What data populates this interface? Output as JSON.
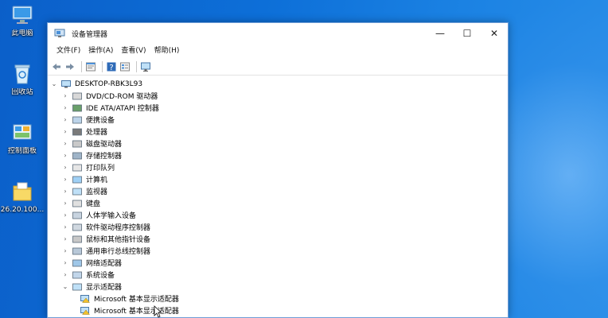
{
  "desktop": {
    "icons": [
      {
        "label": "此电脑",
        "icon": "computer-icon"
      },
      {
        "label": "回收站",
        "icon": "recycle-bin-icon"
      },
      {
        "label": "控制面板",
        "icon": "control-panel-icon"
      },
      {
        "label": "26.20.100...",
        "icon": "folder-icon"
      }
    ]
  },
  "window": {
    "title": "设备管理器",
    "controls": {
      "minimize": "—",
      "maximize": "☐",
      "close": "✕"
    },
    "menu": [
      "文件(F)",
      "操作(A)",
      "查看(V)",
      "帮助(H)"
    ],
    "toolbar": [
      "back-icon",
      "forward-icon",
      "properties-icon",
      "help-icon",
      "view-icon",
      "monitor-icon"
    ]
  },
  "tree": {
    "root": "DESKTOP-RBK3L93",
    "items": [
      {
        "label": "DVD/CD-ROM 驱动器",
        "icon": "dvd-drive-icon",
        "expanded": false
      },
      {
        "label": "IDE ATA/ATAPI 控制器",
        "icon": "ide-controller-icon",
        "expanded": false
      },
      {
        "label": "便携设备",
        "icon": "portable-device-icon",
        "expanded": false
      },
      {
        "label": "处理器",
        "icon": "processor-icon",
        "expanded": false
      },
      {
        "label": "磁盘驱动器",
        "icon": "disk-drive-icon",
        "expanded": false
      },
      {
        "label": "存储控制器",
        "icon": "storage-controller-icon",
        "expanded": false
      },
      {
        "label": "打印队列",
        "icon": "printer-icon",
        "expanded": false
      },
      {
        "label": "计算机",
        "icon": "computer-icon",
        "expanded": false
      },
      {
        "label": "监视器",
        "icon": "monitor-icon",
        "expanded": false
      },
      {
        "label": "键盘",
        "icon": "keyboard-icon",
        "expanded": false
      },
      {
        "label": "人体学输入设备",
        "icon": "hid-icon",
        "expanded": false
      },
      {
        "label": "软件驱动程序控制器",
        "icon": "software-device-icon",
        "expanded": false
      },
      {
        "label": "鼠标和其他指针设备",
        "icon": "mouse-icon",
        "expanded": false
      },
      {
        "label": "通用串行总线控制器",
        "icon": "usb-icon",
        "expanded": false
      },
      {
        "label": "网络适配器",
        "icon": "network-adapter-icon",
        "expanded": false
      },
      {
        "label": "系统设备",
        "icon": "system-device-icon",
        "expanded": false
      },
      {
        "label": "显示适配器",
        "icon": "display-adapter-icon",
        "expanded": true
      }
    ],
    "children": [
      {
        "label": "Microsoft 基本显示适配器",
        "icon": "display-adapter-warning-icon"
      },
      {
        "label": "Microsoft 基本显示适配器",
        "icon": "display-adapter-warning-icon"
      }
    ]
  },
  "colors": {
    "desktop": "#0d6fd8",
    "accent": "#0078d7"
  }
}
